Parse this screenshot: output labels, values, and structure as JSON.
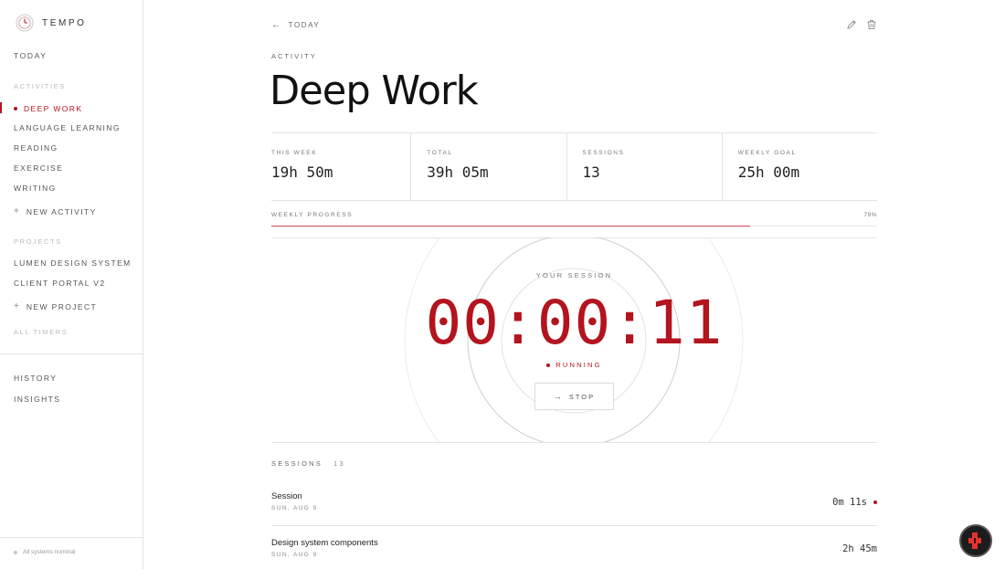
{
  "app": {
    "name": "TEMPO"
  },
  "sidebar": {
    "today": "TODAY",
    "activities_label": "ACTIVITIES",
    "activities": [
      {
        "label": "DEEP WORK",
        "active": true
      },
      {
        "label": "LANGUAGE LEARNING"
      },
      {
        "label": "READING"
      },
      {
        "label": "EXERCISE"
      },
      {
        "label": "WRITING"
      }
    ],
    "new_activity": "NEW ACTIVITY",
    "projects_label": "PROJECTS",
    "projects": [
      {
        "label": "LUMEN DESIGN SYSTEM"
      },
      {
        "label": "CLIENT PORTAL V2"
      }
    ],
    "new_project": "NEW PROJECT",
    "all_timers": "ALL TIMERS",
    "history": "HISTORY",
    "insights": "INSIGHTS",
    "status": "All systems nominal"
  },
  "header": {
    "back": "TODAY",
    "eyebrow": "ACTIVITY",
    "title": "Deep Work"
  },
  "stats": [
    {
      "label": "THIS WEEK",
      "value": "19h 50m"
    },
    {
      "label": "TOTAL",
      "value": "39h 05m"
    },
    {
      "label": "SESSIONS",
      "value": "13"
    },
    {
      "label": "WEEKLY GOAL",
      "value": "25h 00m"
    }
  ],
  "progress": {
    "label": "WEEKLY PROGRESS",
    "percent_text": "79%",
    "fraction": 0.79
  },
  "timer": {
    "label": "YOUR SESSION",
    "time": "00:00:11",
    "status": "RUNNING",
    "stop_label": "STOP"
  },
  "sessions": {
    "label": "SESSIONS",
    "count": "13",
    "items": [
      {
        "name": "Session",
        "date": "SUN, AUG 9",
        "duration": "0m 11s",
        "live": true
      },
      {
        "name": "Design system components",
        "date": "SUN, AUG 9",
        "duration": "2h 45m",
        "live": false
      }
    ]
  },
  "colors": {
    "accent": "#b3141e",
    "border": "#e3e3e3"
  },
  "icons": [
    "clock-logo-icon",
    "arrow-left-icon",
    "pencil-icon",
    "trash-icon",
    "plus-icon",
    "arrow-right-icon",
    "app-badge-icon"
  ]
}
